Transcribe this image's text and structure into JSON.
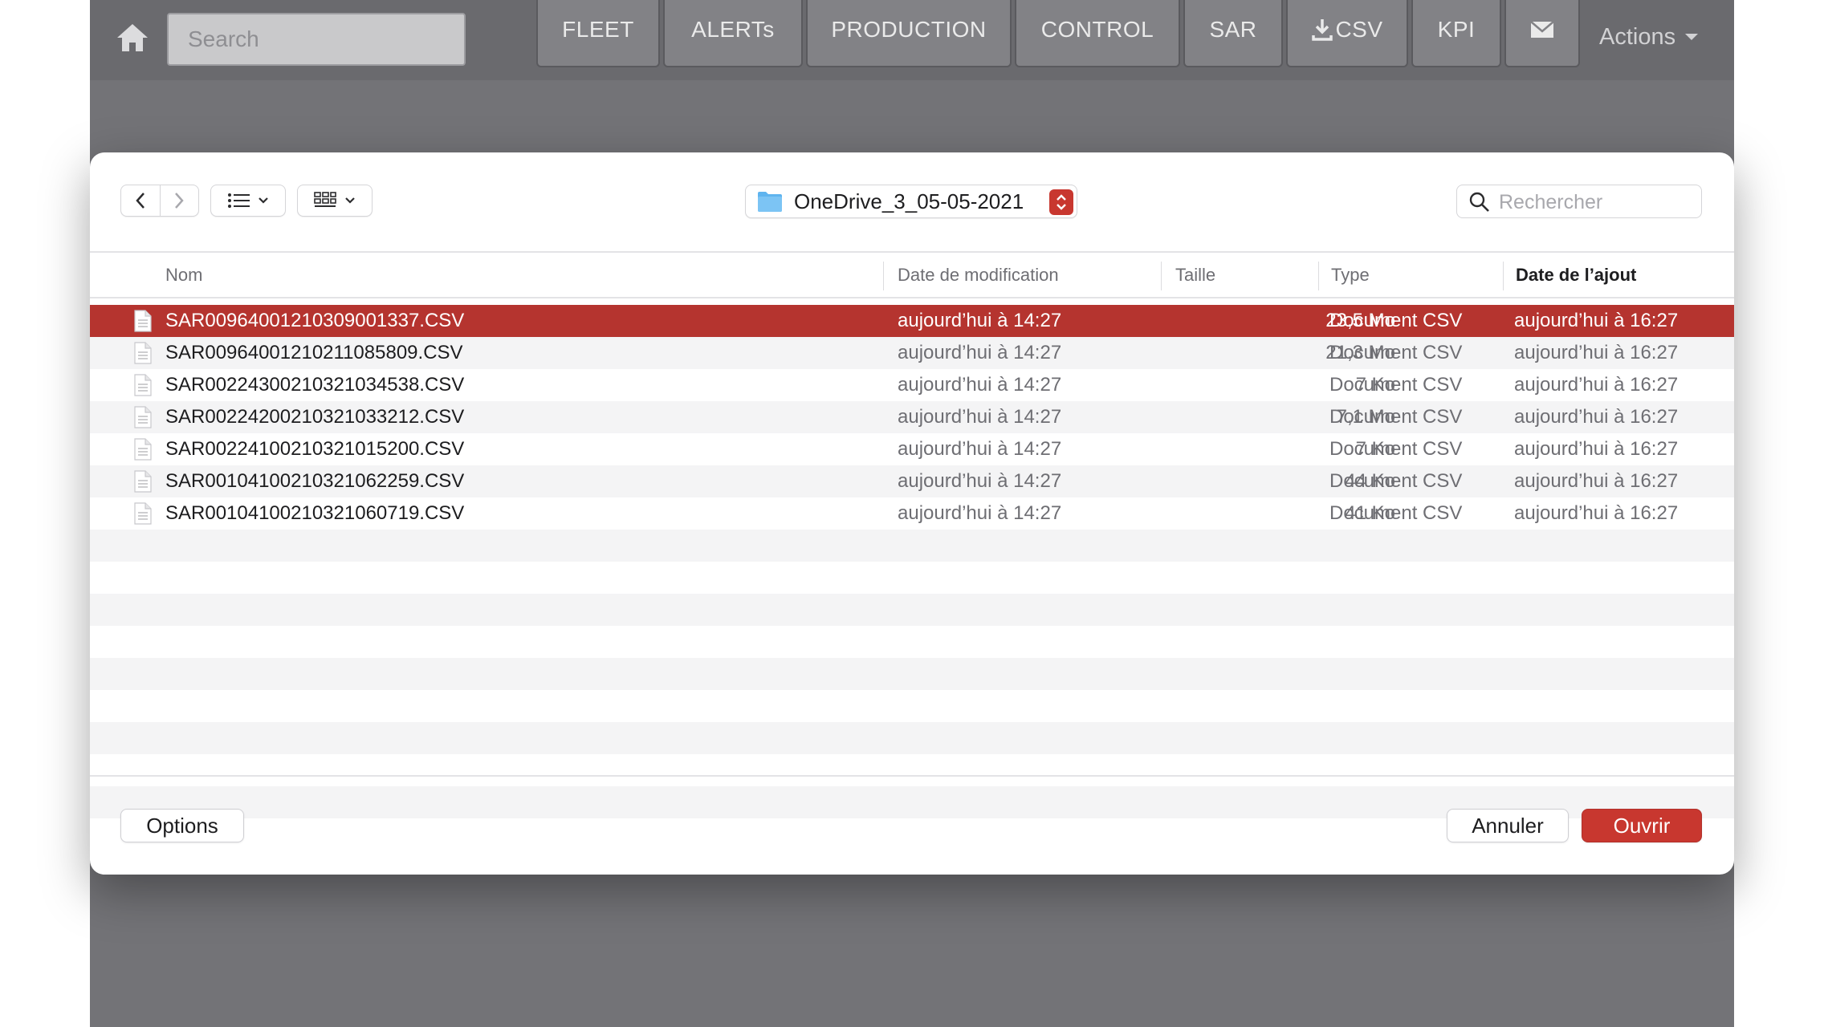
{
  "navbar": {
    "search_placeholder": "Search",
    "buttons": [
      "FLEET",
      "ALERTs",
      "PRODUCTION",
      "CONTROL",
      "SAR",
      "CSV",
      "KPI"
    ],
    "actions_label": "Actions",
    "icons": [
      "home-icon",
      "download-icon",
      "mail-icon",
      "caret-down-icon"
    ]
  },
  "dialog": {
    "location": "OneDrive_3_05-05-2021",
    "search_placeholder": "Rechercher",
    "columns": {
      "name": "Nom",
      "modified": "Date de modification",
      "size": "Taille",
      "type": "Type",
      "added": "Date de l’ajout"
    },
    "sorted_column": "added",
    "files": [
      {
        "name": "SAR00964001210309001337.CSV",
        "modified": "aujourd’hui à 14:27",
        "size": "23,5 Mo",
        "type": "Document CSV",
        "added": "aujourd’hui à 16:27",
        "selected": true
      },
      {
        "name": "SAR00964001210211085809.CSV",
        "modified": "aujourd’hui à 14:27",
        "size": "21,3 Mo",
        "type": "Document CSV",
        "added": "aujourd’hui à 16:27"
      },
      {
        "name": "SAR00224300210321034538.CSV",
        "modified": "aujourd’hui à 14:27",
        "size": "7 Ko",
        "type": "Document CSV",
        "added": "aujourd’hui à 16:27"
      },
      {
        "name": "SAR00224200210321033212.CSV",
        "modified": "aujourd’hui à 14:27",
        "size": "7,1 Mo",
        "type": "Document CSV",
        "added": "aujourd’hui à 16:27"
      },
      {
        "name": "SAR00224100210321015200.CSV",
        "modified": "aujourd’hui à 14:27",
        "size": "7 Ko",
        "type": "Document CSV",
        "added": "aujourd’hui à 16:27"
      },
      {
        "name": "SAR00104100210321062259.CSV",
        "modified": "aujourd’hui à 14:27",
        "size": "44 Ko",
        "type": "Document CSV",
        "added": "aujourd’hui à 16:27"
      },
      {
        "name": "SAR00104100210321060719.CSV",
        "modified": "aujourd’hui à 14:27",
        "size": "41 Ko",
        "type": "Document CSV",
        "added": "aujourd’hui à 16:27"
      }
    ],
    "options_label": "Options",
    "cancel_label": "Annuler",
    "open_label": "Ouvrir"
  },
  "colors": {
    "accent": "#c8372f",
    "selection": "#b5342f",
    "folder": "#5fb4ef"
  }
}
